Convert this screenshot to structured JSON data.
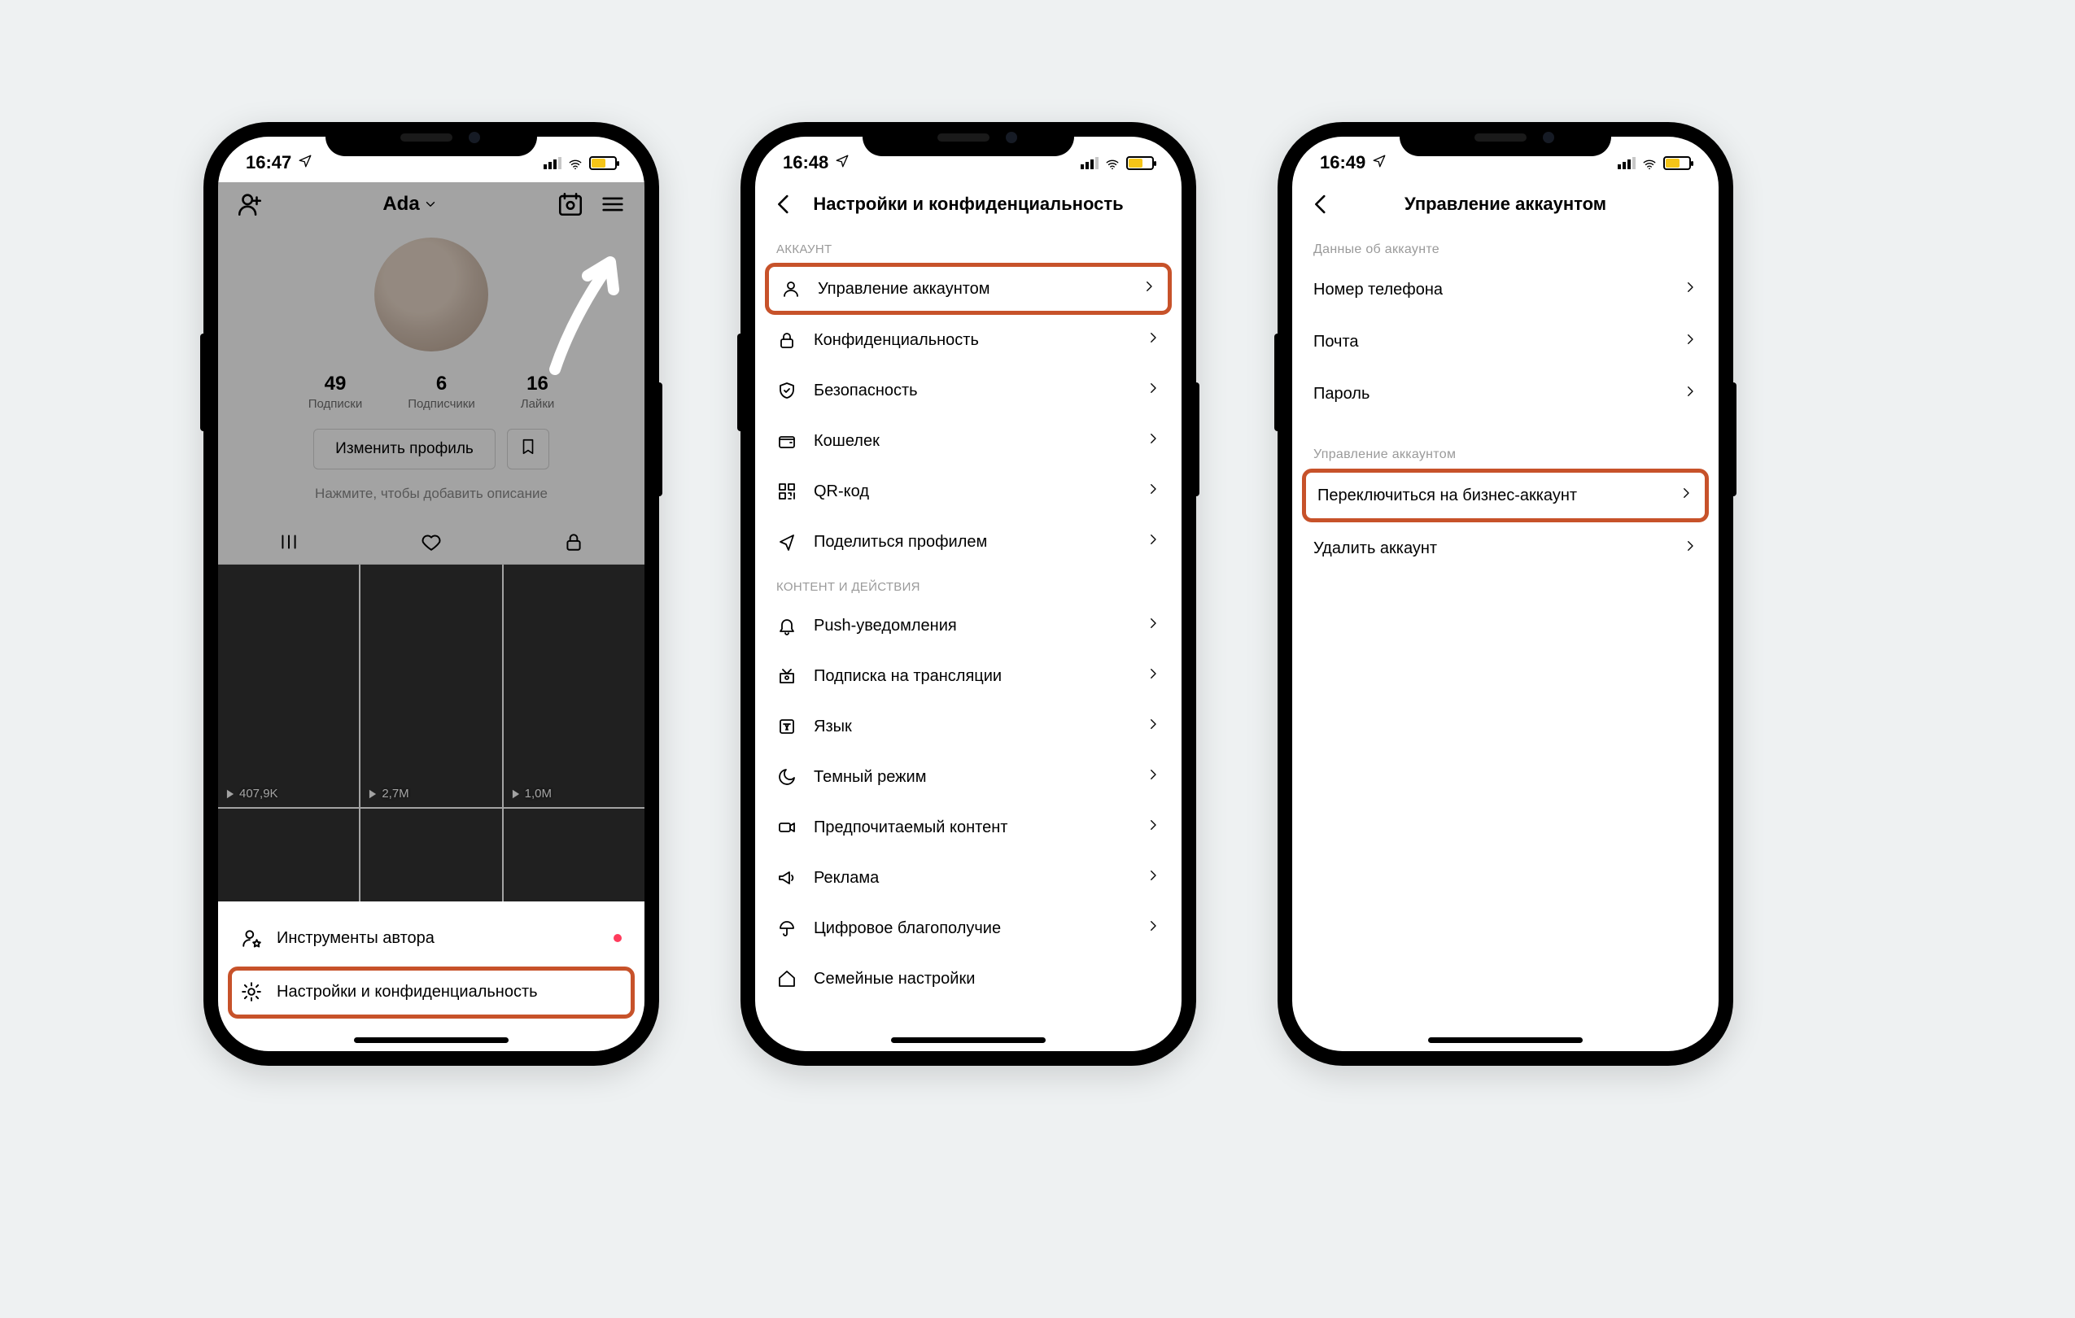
{
  "highlight_color": "#c7522a",
  "phone1": {
    "time": "16:47",
    "username": "Ada",
    "stats": [
      {
        "num": "49",
        "label": "Подписки"
      },
      {
        "num": "6",
        "label": "Подписчики"
      },
      {
        "num": "16",
        "label": "Лайки"
      }
    ],
    "edit_label": "Изменить профиль",
    "bio_placeholder": "Нажмите, чтобы добавить описание",
    "videos": [
      {
        "views": "407,9K"
      },
      {
        "views": "2,7M"
      },
      {
        "views": "1,0M"
      },
      {
        "views": ""
      },
      {
        "views": ""
      },
      {
        "views": ""
      }
    ],
    "sheet": {
      "creator_tools": "Инструменты автора",
      "settings": "Настройки и конфиденциальность"
    }
  },
  "phone2": {
    "time": "16:48",
    "title": "Настройки и конфиденциальность",
    "section_account": "АККАУНТ",
    "section_content": "КОНТЕНТ И ДЕЙСТВИЯ",
    "items_account": [
      "Управление аккаунтом",
      "Конфиденциальность",
      "Безопасность",
      "Кошелек",
      "QR-код",
      "Поделиться профилем"
    ],
    "items_content": [
      "Push-уведомления",
      "Подписка на трансляции",
      "Язык",
      "Темный режим",
      "Предпочитаемый контент",
      "Реклама",
      "Цифровое благополучие",
      "Семейные настройки"
    ]
  },
  "phone3": {
    "time": "16:49",
    "title": "Управление аккаунтом",
    "section_info": "Данные об аккаунте",
    "section_mgmt": "Управление аккаунтом",
    "items_info": [
      "Номер телефона",
      "Почта",
      "Пароль"
    ],
    "items_mgmt": [
      "Переключиться на бизнес-аккаунт",
      "Удалить аккаунт"
    ]
  }
}
